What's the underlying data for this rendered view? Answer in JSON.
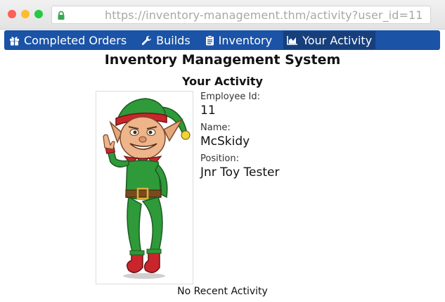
{
  "browser": {
    "url": "https://inventory-management.thm/activity?user_id=11"
  },
  "nav": {
    "items": [
      {
        "label": "Completed Orders",
        "icon": "gift-icon",
        "active": false
      },
      {
        "label": "Builds",
        "icon": "wrench-icon",
        "active": false
      },
      {
        "label": "Inventory",
        "icon": "clipboard-icon",
        "active": false
      },
      {
        "label": "Your Activity",
        "icon": "area-chart-icon",
        "active": true
      }
    ],
    "colors": {
      "bar": "#1b53a6",
      "active": "#163f7c"
    }
  },
  "page": {
    "title": "Inventory Management System",
    "section_title": "Your Activity"
  },
  "profile": {
    "image": "elf-character-illustration",
    "employee_id_label": "Employee Id:",
    "employee_id": "11",
    "name_label": "Name:",
    "name": "McSkidy",
    "position_label": "Position:",
    "position": "Jnr Toy Tester"
  },
  "activity": {
    "empty_text": "No Recent Activity"
  }
}
